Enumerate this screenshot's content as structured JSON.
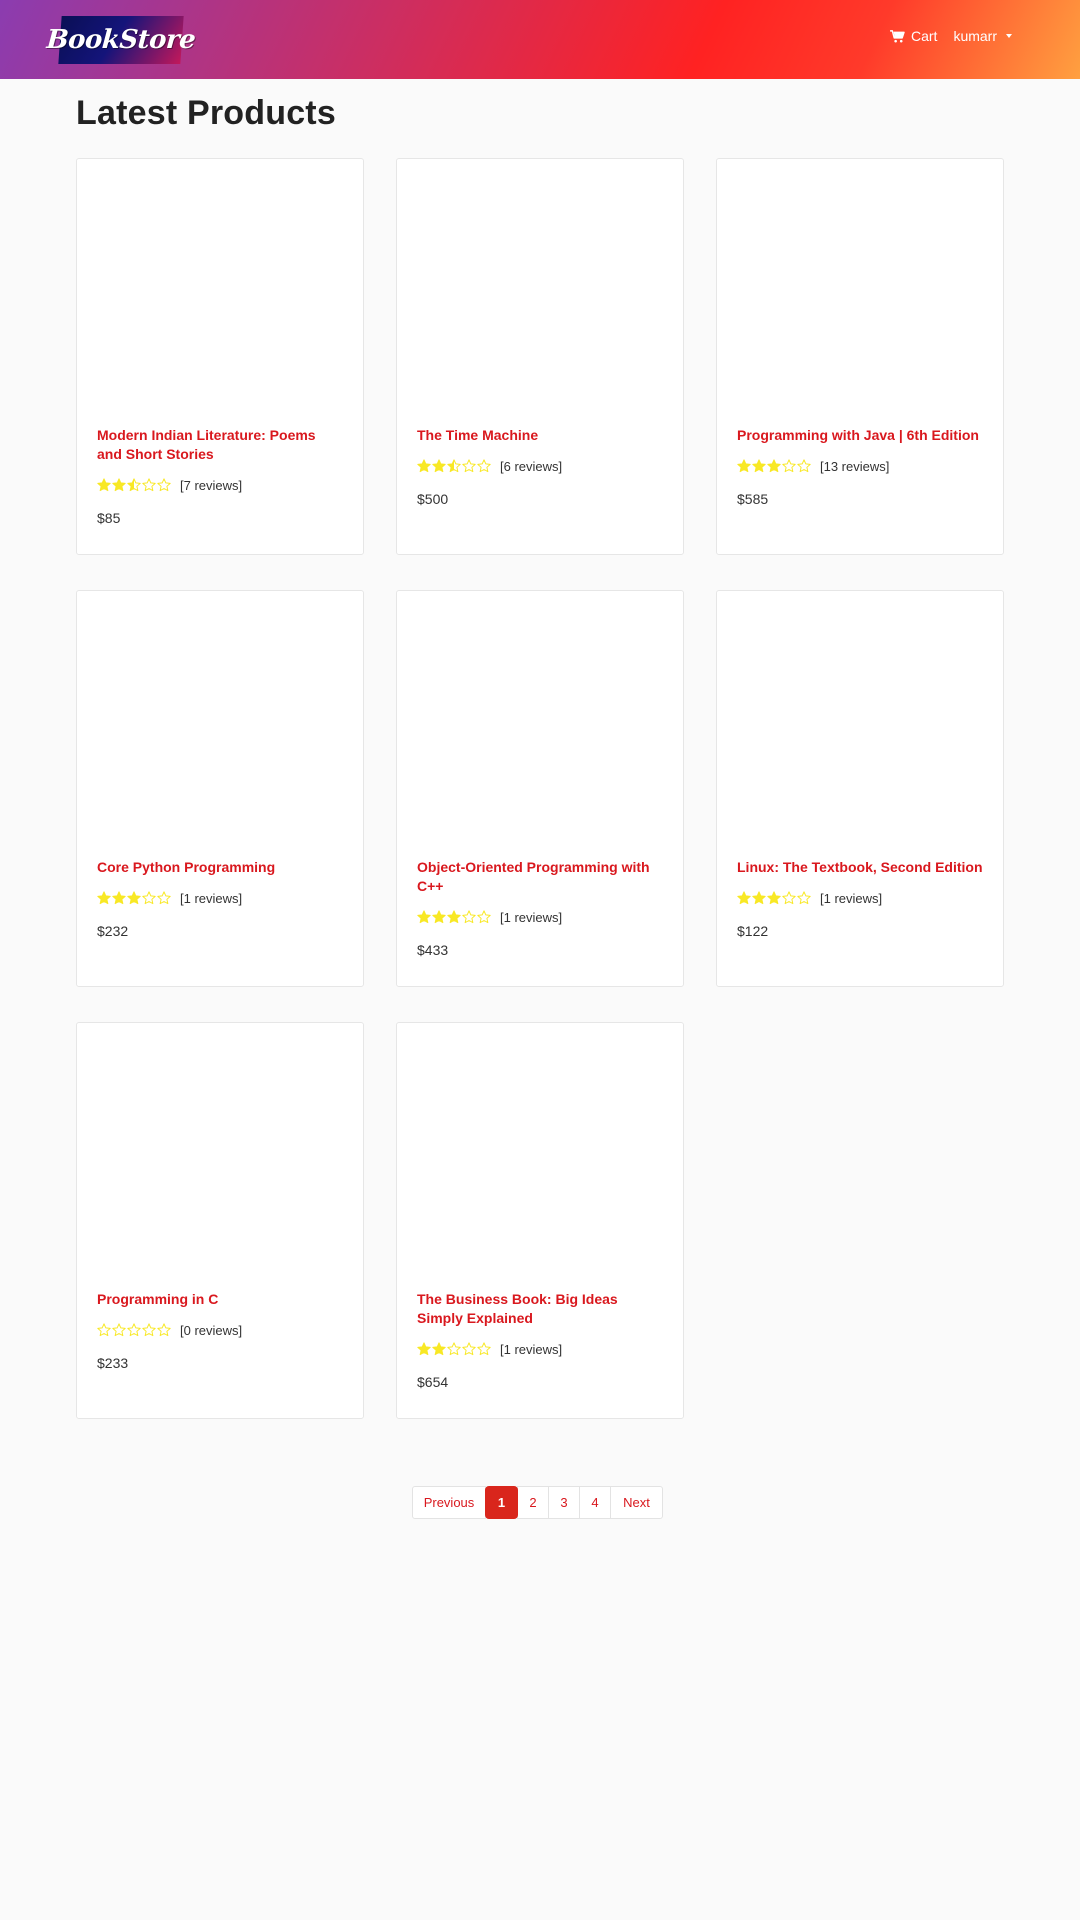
{
  "brand": {
    "logo_text": "BookStore"
  },
  "nav": {
    "cart_label": "Cart",
    "user_label": "kumarr"
  },
  "page": {
    "title": "Latest Products"
  },
  "products": [
    {
      "title": "Modern Indian Literature: Poems and Short Stories",
      "rating": 2.5,
      "reviews": "[7 reviews]",
      "price": "$85"
    },
    {
      "title": "The Time Machine",
      "rating": 2.5,
      "reviews": "[6 reviews]",
      "price": "$500"
    },
    {
      "title": "Programming with Java | 6th Edition",
      "rating": 3,
      "reviews": "[13 reviews]",
      "price": "$585"
    },
    {
      "title": "Core Python Programming",
      "rating": 3,
      "reviews": "[1 reviews]",
      "price": "$232"
    },
    {
      "title": "Object-Oriented Programming with C++",
      "rating": 3,
      "reviews": "[1 reviews]",
      "price": "$433"
    },
    {
      "title": "Linux: The Textbook, Second Edition",
      "rating": 3,
      "reviews": "[1 reviews]",
      "price": "$122"
    },
    {
      "title": "Programming in C",
      "rating": 0,
      "reviews": "[0 reviews]",
      "price": "$233"
    },
    {
      "title": "The Business Book: Big Ideas Simply Explained",
      "rating": 2,
      "reviews": "[1 reviews]",
      "price": "$654"
    }
  ],
  "pagination": {
    "previous": "Previous",
    "pages": [
      "1",
      "2",
      "3",
      "4"
    ],
    "active": "1",
    "next": "Next"
  },
  "colors": {
    "accent": "#d9181e",
    "star": "#f8e825"
  }
}
